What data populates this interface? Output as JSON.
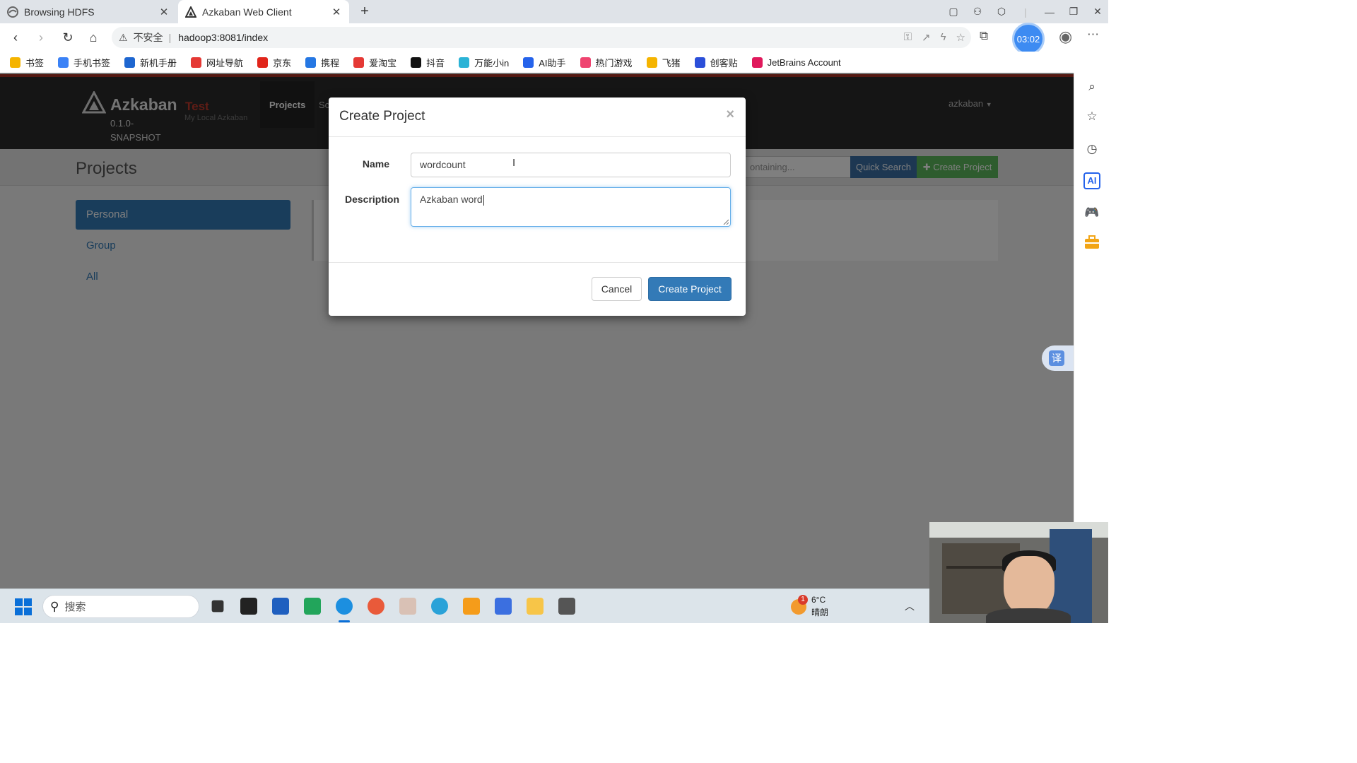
{
  "browser": {
    "tabs": [
      {
        "title": "Browsing HDFS",
        "active": false
      },
      {
        "title": "Azkaban Web Client",
        "active": true
      }
    ],
    "new_tab": "+",
    "address": {
      "warning": "⚠",
      "security_label": "不安全",
      "url": "hadoop3:8081/index"
    },
    "timer": "03:02",
    "bookmarks": [
      {
        "label": "书签",
        "color": "#f5b400"
      },
      {
        "label": "手机书签",
        "color": "#3b82f6"
      },
      {
        "label": "新机手册",
        "color": "#1e66d0"
      },
      {
        "label": "网址导航",
        "color": "#e53935"
      },
      {
        "label": "京东",
        "color": "#e1251b"
      },
      {
        "label": "携程",
        "color": "#2577e3"
      },
      {
        "label": "爱淘宝",
        "color": "#e53935"
      },
      {
        "label": "抖音",
        "color": "#111111"
      },
      {
        "label": "万能小in",
        "color": "#2bb3d6"
      },
      {
        "label": "AI助手",
        "color": "#2563eb"
      },
      {
        "label": "热门游戏",
        "color": "#ef4470"
      },
      {
        "label": "飞猪",
        "color": "#f5b400"
      },
      {
        "label": "创客贴",
        "color": "#2b4fd9"
      },
      {
        "label": "JetBrains Account",
        "color": "#e0195c"
      }
    ]
  },
  "azkaban": {
    "brand": "Azkaban",
    "version": "0.1.0-SNAPSHOT",
    "env_name": "Test",
    "env_sub": "My Local Azkaban",
    "nav": {
      "projects": "Projects",
      "scheduling_partial": "Sc"
    },
    "user": "azkaban",
    "page_title": "Projects",
    "search_placeholder": "ontaining...",
    "quick_search": "Quick Search",
    "create_project": "Create Project",
    "sidenav": [
      "Personal",
      "Group",
      "All"
    ]
  },
  "modal": {
    "title": "Create Project",
    "close": "×",
    "name_label": "Name",
    "name_value": "wordcount",
    "description_label": "Description",
    "description_value": "Azkaban word",
    "cancel": "Cancel",
    "submit": "Create Project"
  },
  "translate_icon": "译",
  "taskbar": {
    "search_label": "搜索",
    "weather_badge": "1",
    "temperature": "6°C",
    "condition": "晴朗"
  }
}
